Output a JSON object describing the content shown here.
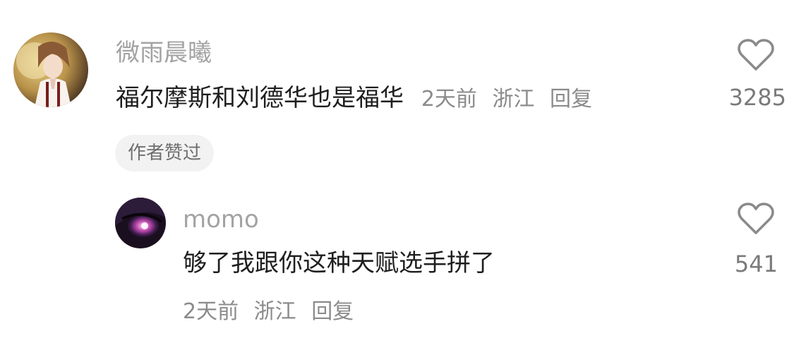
{
  "comments": [
    {
      "avatar_icon": "anime-boy-avatar",
      "username": "微雨晨曦",
      "text": "福尔摩斯和刘德华也是福华",
      "time": "2天前",
      "location": "浙江",
      "reply_label": "回复",
      "like_icon": "heart-outline-icon",
      "like_count": "3285",
      "badge": "作者赞过"
    },
    {
      "avatar_icon": "anime-girl-eye-avatar",
      "username": "momo",
      "text": "够了我跟你这种天赋选手拼了",
      "time": "2天前",
      "location": "浙江",
      "reply_label": "回复",
      "like_icon": "heart-outline-icon",
      "like_count": "541"
    }
  ],
  "colors": {
    "username": "#a3a3a3",
    "text": "#1e1e1e",
    "meta": "#8b8b8b",
    "badge_bg": "#f2f2f2"
  }
}
